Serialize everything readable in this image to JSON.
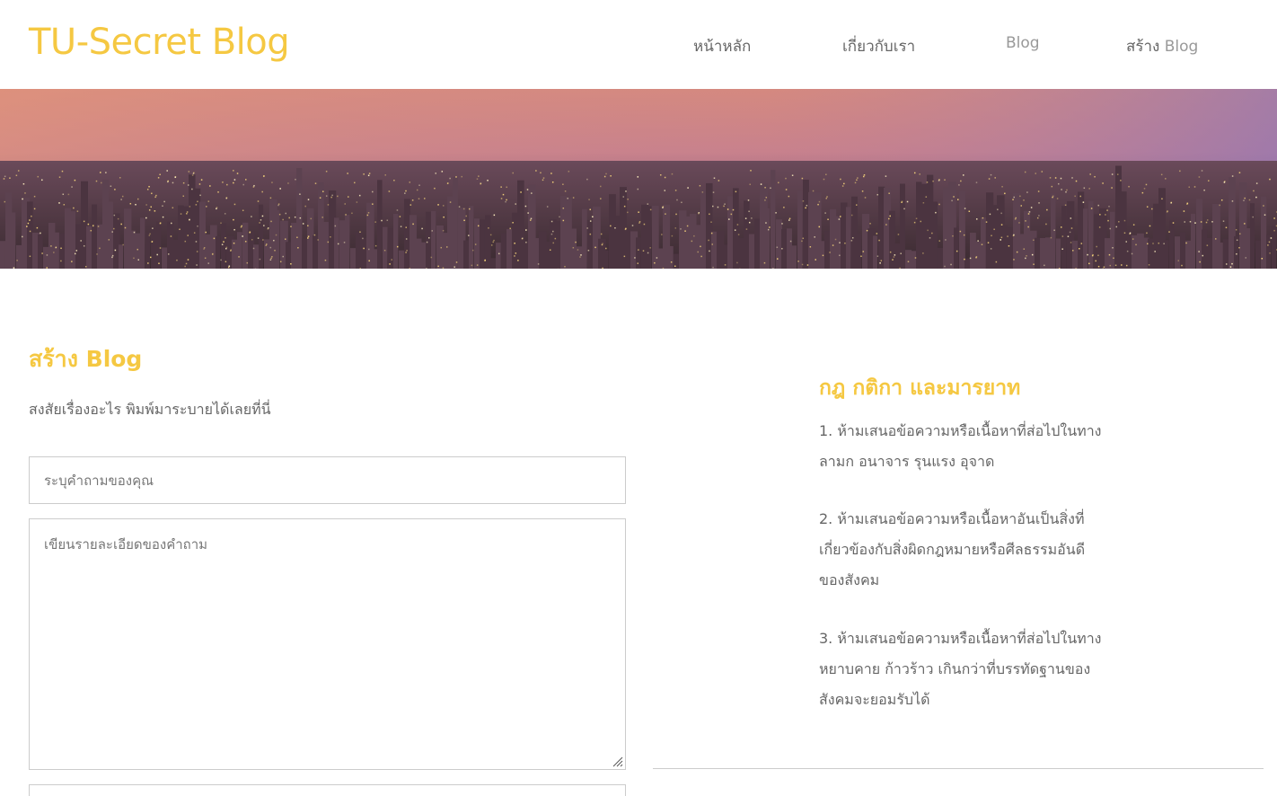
{
  "header": {
    "brand": "TU-Secret Blog",
    "nav": {
      "home": "หน้าหลัก",
      "about": "เกี่ยวกับเรา",
      "blog": "Blog",
      "create_prefix": "สร้าง",
      "create_suffix": "Blog"
    }
  },
  "main": {
    "heading": "สร้าง Blog",
    "subheading": "สงสัยเรื่องอะไร พิมพ์มาระบายได้เลยที่นี่",
    "form": {
      "question_placeholder": "ระบุคำถามของคุณ",
      "details_placeholder": "เขียนรายละเอียดของคำถาม"
    }
  },
  "sidebar": {
    "title": "กฎ กติกา และมารยาท",
    "rules": [
      "1. ห้ามเสนอข้อความหรือเนื้อหาที่ส่อไปในทาง ลามก อนาจาร รุนแรง อุจาด",
      "2. ห้ามเสนอข้อความหรือเนื้อหาอันเป็นสิ่งที่เกี่ยวข้องกับสิ่งผิดกฎหมายหรือศีลธรรมอันดีของสังคม",
      "3. ห้ามเสนอข้อความหรือเนื้อหาที่ส่อไปในทางหยาบคาย ก้าวร้าว เกินกว่าที่บรรทัดฐานของสังคมจะยอมรับได้"
    ]
  },
  "colors": {
    "accent": "#f5c842",
    "text": "#666666",
    "muted": "#999999",
    "border": "#cccccc"
  }
}
